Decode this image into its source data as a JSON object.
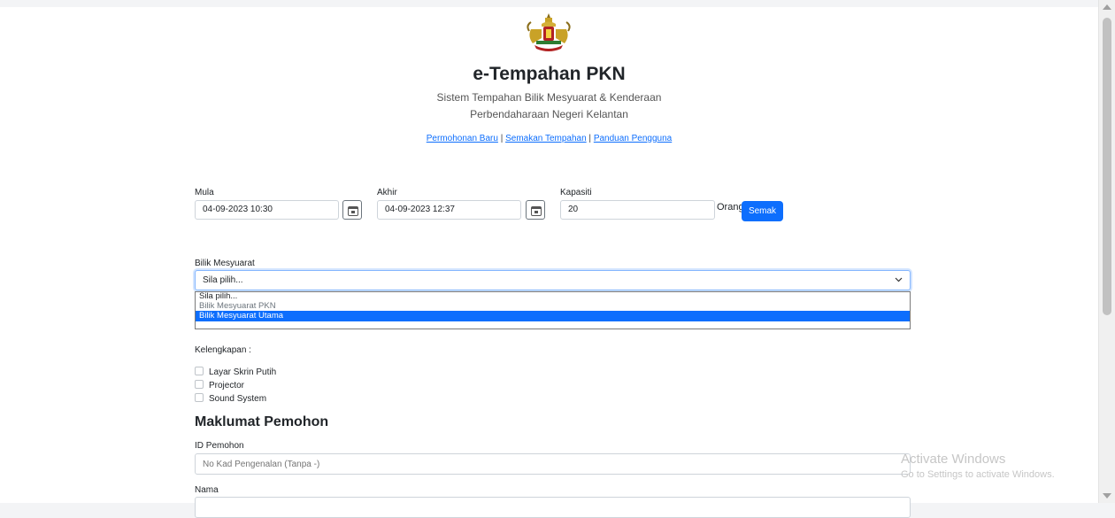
{
  "header": {
    "title": "e-Tempahan PKN",
    "subtitle_line1": "Sistem Tempahan Bilik Mesyuarat & Kenderaan",
    "subtitle_line2": "Perbendaharaan Negeri Kelantan",
    "links": [
      {
        "label": "Permohonan Baru"
      },
      {
        "label": "Semakan Tempahan"
      },
      {
        "label": "Panduan Pengguna"
      }
    ],
    "separator": "|"
  },
  "search": {
    "start_label": "Mula",
    "start_value": "04-09-2023 10:30",
    "end_label": "Akhir",
    "end_value": "04-09-2023 12:37",
    "capacity_label": "Kapasiti",
    "capacity_value": "20",
    "capacity_unit": "Orang",
    "check_button": "Semak"
  },
  "room": {
    "label": "Bilik Mesyuarat",
    "selected": "Sila pilih...",
    "options": [
      "Sila pilih...",
      "Bilik Mesyuarat PKN",
      "Bilik Mesyuarat Utama"
    ],
    "highlighted_index": 2
  },
  "equipment": {
    "label": "Kelengkapan :",
    "items": [
      "Layar Skrin Putih",
      "Projector",
      "Sound System"
    ]
  },
  "applicant": {
    "section_title": "Maklumat Pemohon",
    "id_label": "ID Pemohon",
    "id_placeholder": "No Kad Pengenalan (Tanpa -)",
    "name_label": "Nama"
  },
  "watermark": {
    "line1": "Activate Windows",
    "line2": "Go to Settings to activate Windows."
  },
  "colors": {
    "primary": "#0d6efd",
    "page_background": "#ffffff",
    "outer_background": "#f3f4f6"
  }
}
